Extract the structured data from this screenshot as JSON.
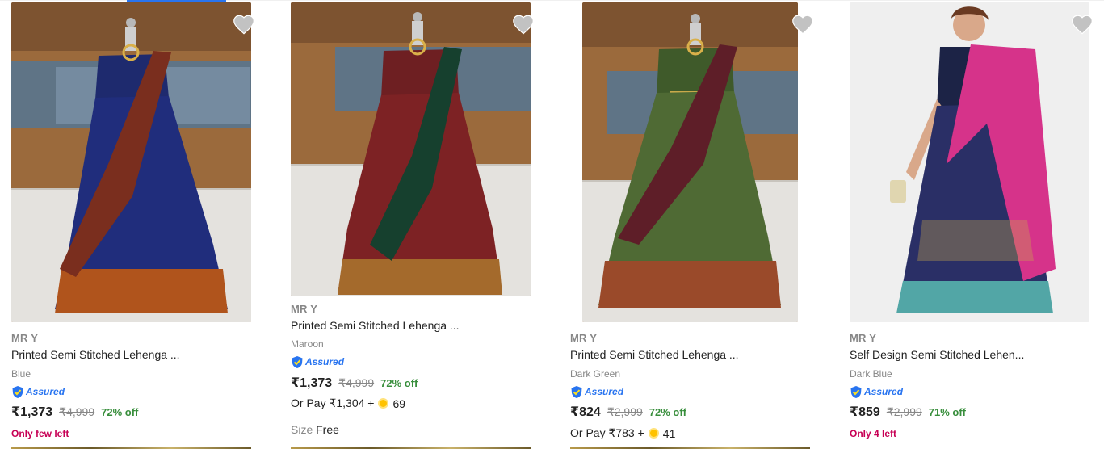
{
  "currency": "₹",
  "products": [
    {
      "brand": "MR Y",
      "title": "Printed Semi Stitched Lehenga ...",
      "color": "Blue",
      "assured": "Assured",
      "price": "₹1,373",
      "mrp": "₹4,999",
      "discount": "72% off",
      "stock_note": "Only few left",
      "colors": {
        "bodice": "#1e2a6e",
        "skirt": "#202d7c",
        "drape": "#7a2e1e",
        "border": "#b0541c"
      }
    },
    {
      "brand": "MR Y",
      "title": "Printed Semi Stitched Lehenga ...",
      "color": "Maroon",
      "assured": "Assured",
      "price": "₹1,373",
      "mrp": "₹4,999",
      "discount": "72% off",
      "or_pay_text": "Or Pay ₹1,304 +",
      "or_pay_coins": "69",
      "size_label": "Size",
      "size_value": "Free",
      "colors": {
        "bodice": "#6e1f22",
        "skirt": "#7d2224",
        "drape": "#16402e",
        "border": "#a46a2c"
      }
    },
    {
      "brand": "MR Y",
      "title": "Printed Semi Stitched Lehenga ...",
      "color": "Dark Green",
      "assured": "Assured",
      "price": "₹824",
      "mrp": "₹2,999",
      "discount": "72% off",
      "or_pay_text": "Or Pay ₹783 +",
      "or_pay_coins": "41",
      "colors": {
        "bodice": "#3f5a2a",
        "skirt": "#4f6a34",
        "drape": "#5e1e28",
        "border": "#9a4a2a"
      }
    },
    {
      "brand": "MR Y",
      "title": "Self Design Semi Stitched Lehen...",
      "color": "Dark Blue",
      "assured": "Assured",
      "price": "₹859",
      "mrp": "₹2,999",
      "discount": "71% off",
      "stock_note": "Only 4 left",
      "colors": {
        "bodice": "#1c2346",
        "skirt": "#2a2f66",
        "drape": "#d6338a",
        "border": "#52a6a6"
      }
    }
  ]
}
